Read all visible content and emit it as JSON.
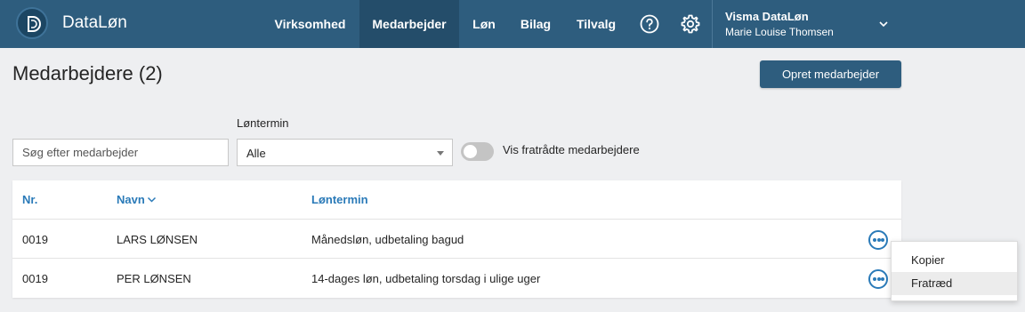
{
  "topbar": {
    "app_name": "DataLøn",
    "nav": [
      {
        "label": "Virksomhed",
        "active": false
      },
      {
        "label": "Medarbejder",
        "active": true
      },
      {
        "label": "Løn",
        "active": false
      },
      {
        "label": "Bilag",
        "active": false
      },
      {
        "label": "Tilvalg",
        "active": false
      }
    ],
    "icons": {
      "help": "help-circle-icon",
      "settings": "gear-icon",
      "user_menu": "chevron-down-icon"
    },
    "user": {
      "company": "Visma DataLøn",
      "name": "Marie Louise Thomsen"
    }
  },
  "page": {
    "title": "Medarbejdere (2)",
    "create_button": "Opret medarbejder"
  },
  "filters": {
    "search_placeholder": "Søg efter medarbejder",
    "search_value": "",
    "pay_period_label": "Løntermin",
    "pay_period_value": "Alle",
    "show_terminated_label": "Vis fratrådte medarbejdere",
    "show_terminated_on": false
  },
  "table": {
    "columns": [
      "Nr.",
      "Navn",
      "Løntermin"
    ],
    "sort_column": "Navn",
    "rows": [
      {
        "nr": "0019",
        "name": "LARS LØNSEN",
        "pay_period": "Månedsløn, udbetaling bagud"
      },
      {
        "nr": "0019",
        "name": "PER LØNSEN",
        "pay_period": "14-dages løn, udbetaling torsdag i ulige uger"
      }
    ]
  },
  "context_menu": {
    "items": [
      "Kopier",
      "Fratræd"
    ],
    "hovered": "Fratræd"
  },
  "colors": {
    "topbar": "#2e5d7e",
    "topbar_active": "#244d6a",
    "accent_link": "#2a7ab8",
    "background": "#eeeff1"
  }
}
